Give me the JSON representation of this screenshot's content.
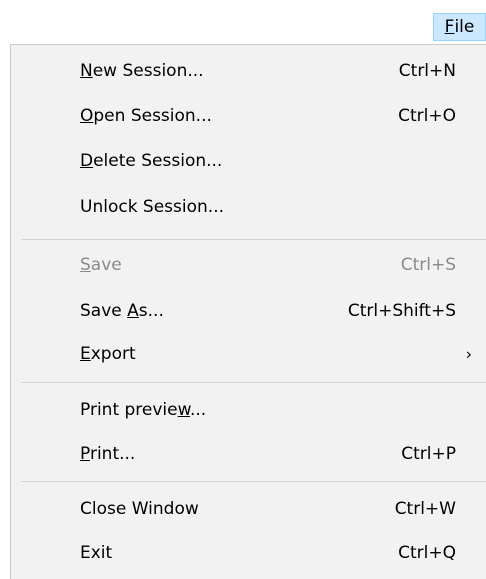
{
  "menubar": {
    "file": {
      "accel": "F",
      "rest": "ile"
    }
  },
  "menu": {
    "items": [
      {
        "pre": "",
        "accel": "N",
        "post": "ew Session...",
        "shortcut": "Ctrl+N"
      },
      {
        "pre": "",
        "accel": "O",
        "post": "pen Session...",
        "shortcut": "Ctrl+O"
      },
      {
        "pre": "",
        "accel": "D",
        "post": "elete Session...",
        "shortcut": ""
      },
      {
        "pre": "Unlock Session...",
        "accel": "",
        "post": "",
        "shortcut": ""
      },
      {
        "pre": "",
        "accel": "S",
        "post": "ave",
        "shortcut": "Ctrl+S"
      },
      {
        "pre": "Save ",
        "accel": "A",
        "post": "s...",
        "shortcut": "Ctrl+Shift+S"
      },
      {
        "pre": "",
        "accel": "E",
        "post": "xport",
        "shortcut": "",
        "arrow": "›"
      },
      {
        "pre": "Print previe",
        "accel": "w",
        "post": "...",
        "shortcut": ""
      },
      {
        "pre": "",
        "accel": "P",
        "post": "rint...",
        "shortcut": "Ctrl+P"
      },
      {
        "pre": "Close Window",
        "accel": "",
        "post": "",
        "shortcut": "Ctrl+W"
      },
      {
        "pre": "Exit",
        "accel": "",
        "post": "",
        "shortcut": "Ctrl+Q"
      }
    ]
  }
}
